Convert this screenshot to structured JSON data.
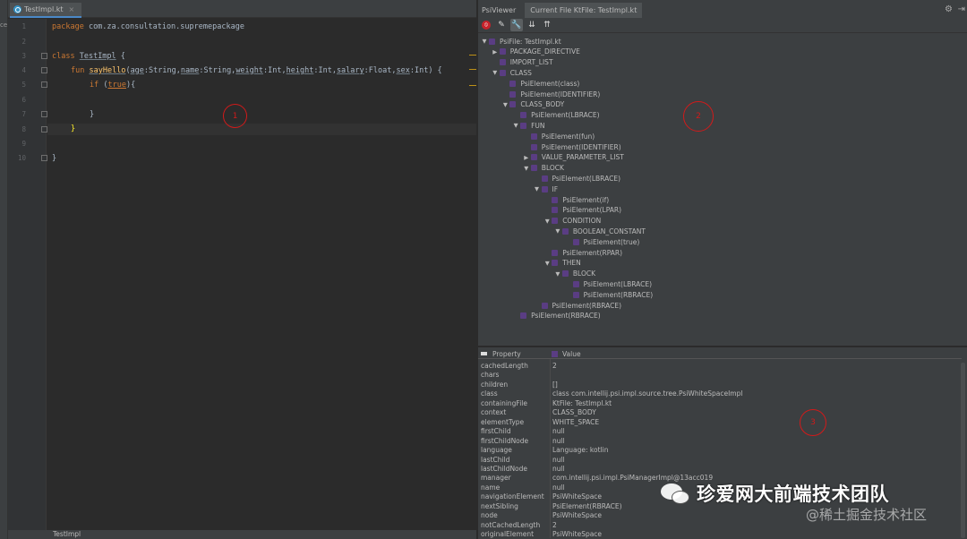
{
  "left_strip_label": "ce",
  "editor": {
    "tab_label": "TestImpl.kt",
    "tab_close": "×",
    "line_numbers": [
      "1",
      "2",
      "3",
      "4",
      "5",
      "6",
      "7",
      "8",
      "9",
      "10"
    ],
    "lines": {
      "l1_kw": "package",
      "l1_rest": " com.za.consultation.supremepackage",
      "l3_kw": "class",
      "l3_name": "TestImpl",
      "l3_rest": " {",
      "l4_kw": "fun",
      "l4_fn": "sayHello",
      "l4_p1": "age",
      "l4_t1": ":String,",
      "l4_p2": "name",
      "l4_t2": ":String,",
      "l4_p3": "weight",
      "l4_t3": ":Int,",
      "l4_p4": "height",
      "l4_t4": ":Int,",
      "l4_p5": "salary",
      "l4_t5": ":Float,",
      "l4_p6": "sex",
      "l4_t6": ":Int) {",
      "l5_kw": "if",
      "l5_cond": "true",
      "l5_rest": "){",
      "l7": "}",
      "l8": "}",
      "l10": "}"
    },
    "status_text": "TestImpl",
    "annotation1": "1"
  },
  "psi": {
    "title": "PsiViewer",
    "tab": "Current File KtFile: TestImpl.kt",
    "annotation2": "2",
    "tree": [
      {
        "label": "PsiFile: TestImpl.kt",
        "arrow": "▼"
      },
      {
        "label": "PACKAGE_DIRECTIVE",
        "arrow": "▶"
      },
      {
        "label": "IMPORT_LIST",
        "arrow": ""
      },
      {
        "label": "CLASS",
        "arrow": "▼"
      },
      {
        "label": "PsiElement(class)",
        "arrow": ""
      },
      {
        "label": "PsiElement(IDENTIFIER)",
        "arrow": ""
      },
      {
        "label": "CLASS_BODY",
        "arrow": "▼"
      },
      {
        "label": "PsiElement(LBRACE)",
        "arrow": ""
      },
      {
        "label": "FUN",
        "arrow": "▼"
      },
      {
        "label": "PsiElement(fun)",
        "arrow": ""
      },
      {
        "label": "PsiElement(IDENTIFIER)",
        "arrow": ""
      },
      {
        "label": "VALUE_PARAMETER_LIST",
        "arrow": "▶"
      },
      {
        "label": "BLOCK",
        "arrow": "▼"
      },
      {
        "label": "PsiElement(LBRACE)",
        "arrow": ""
      },
      {
        "label": "IF",
        "arrow": "▼"
      },
      {
        "label": "PsiElement(if)",
        "arrow": ""
      },
      {
        "label": "PsiElement(LPAR)",
        "arrow": ""
      },
      {
        "label": "CONDITION",
        "arrow": "▼"
      },
      {
        "label": "BOOLEAN_CONSTANT",
        "arrow": "▼"
      },
      {
        "label": "PsiElement(true)",
        "arrow": ""
      },
      {
        "label": "PsiElement(RPAR)",
        "arrow": ""
      },
      {
        "label": "THEN",
        "arrow": "▼"
      },
      {
        "label": "BLOCK",
        "arrow": "▼"
      },
      {
        "label": "PsiElement(LBRACE)",
        "arrow": ""
      },
      {
        "label": "PsiElement(RBRACE)",
        "arrow": ""
      },
      {
        "label": "PsiElement(RBRACE)",
        "arrow": ""
      },
      {
        "label": "PsiElement(RBRACE)",
        "arrow": ""
      }
    ]
  },
  "properties": {
    "col_property": "Property",
    "col_value": "Value",
    "annotation3": "3",
    "rows": [
      {
        "k": "cachedLength",
        "v": "2"
      },
      {
        "k": "chars",
        "v": ""
      },
      {
        "k": "children",
        "v": "[]"
      },
      {
        "k": "class",
        "v": "class com.intellij.psi.impl.source.tree.PsiWhiteSpaceImpl"
      },
      {
        "k": "containingFile",
        "v": "KtFile: TestImpl.kt"
      },
      {
        "k": "context",
        "v": "CLASS_BODY"
      },
      {
        "k": "elementType",
        "v": "WHITE_SPACE"
      },
      {
        "k": "firstChild",
        "v": "null"
      },
      {
        "k": "firstChildNode",
        "v": "null"
      },
      {
        "k": "language",
        "v": "Language: kotlin"
      },
      {
        "k": "lastChild",
        "v": "null"
      },
      {
        "k": "lastChildNode",
        "v": "null"
      },
      {
        "k": "manager",
        "v": "com.intellij.psi.impl.PsiManagerImpl@13acc019"
      },
      {
        "k": "name",
        "v": "null"
      },
      {
        "k": "navigationElement",
        "v": "PsiWhiteSpace"
      },
      {
        "k": "nextSibling",
        "v": "PsiElement(RBRACE)"
      },
      {
        "k": "node",
        "v": "PsiWhiteSpace"
      },
      {
        "k": "notCachedLength",
        "v": "2"
      },
      {
        "k": "originalElement",
        "v": "PsiWhiteSpace"
      }
    ]
  },
  "watermark": {
    "main": "珍爱网大前端技术团队",
    "sub": "@稀土掘金技术社区"
  }
}
